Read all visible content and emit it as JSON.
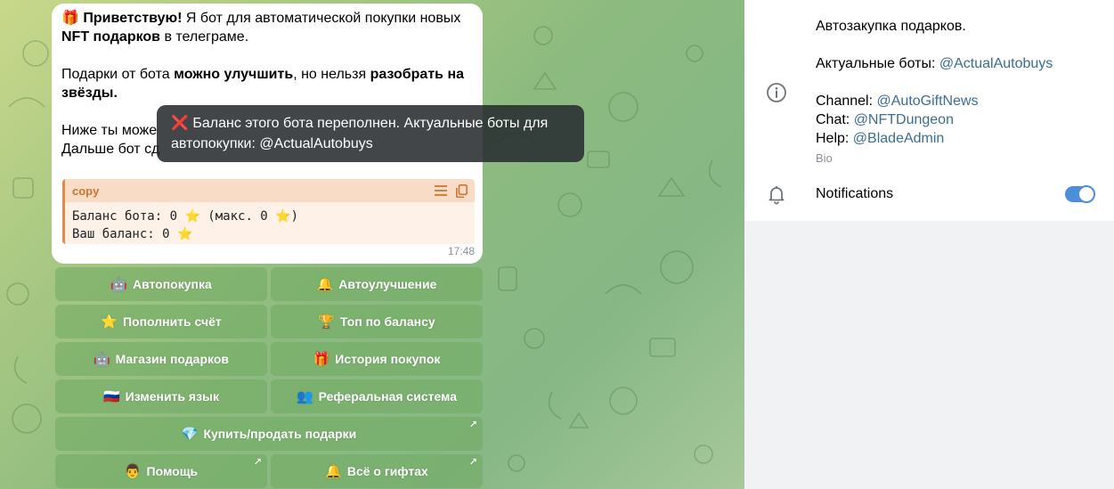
{
  "message": {
    "line1_icon": "🎁",
    "line1_bold": "Приветствую!",
    "line1_rest": " Я бот для автоматической покупки новых",
    "line2_bold": "NFT подарков",
    "line2_rest": " в телеграме.",
    "line3_a": "Подарки от бота ",
    "line3_bold1": "можно улучшить",
    "line3_b": ", но нельзя ",
    "line3_bold2": "разобрать на",
    "line4_bold": "звёзды.",
    "line5": "Ниже ты може",
    "line6": "Дальше бот сд",
    "code_lang": "copy",
    "code_line1_a": "Баланс бота: 0 ",
    "code_line1_b": " (макс. 0 ",
    "code_line1_c": ")",
    "code_line2": "Ваш баланс: 0 ",
    "star": "⭐",
    "time": "17:48"
  },
  "toast": {
    "icon": "❌",
    "text": " Баланс этого бота переполнен. Актуальные боты для автопокупки: @ActualAutobuys"
  },
  "keyboard": {
    "autobuy": {
      "emoji": "🤖",
      "label": "Автопокупка"
    },
    "autoupgrade": {
      "emoji": "🔔",
      "label": "Автоулучшение"
    },
    "topup": {
      "emoji": "⭐",
      "label": "Пополнить счёт"
    },
    "top": {
      "emoji": "🏆",
      "label": "Топ по балансу"
    },
    "shop": {
      "emoji": "🤖",
      "label": "Магазин подарков"
    },
    "history": {
      "emoji": "🎁",
      "label": "История покупок"
    },
    "language": {
      "emoji": "🇷🇺",
      "label": "Изменить язык"
    },
    "referral": {
      "emoji": "👥",
      "label": "Реферальная система"
    },
    "buysell": {
      "emoji": "💎",
      "label": "Купить/продать подарки",
      "arrow": "↗"
    },
    "help": {
      "emoji": "👨",
      "label": "Помощь",
      "arrow": "↗"
    },
    "about": {
      "emoji": "🔔",
      "label": "Всё о гифтах",
      "arrow": "↗"
    }
  },
  "profile": {
    "bio_line1": "Автозакупка подарков.",
    "actual_prefix": "Актуальные боты: ",
    "actual_link": "@ActualAutobuys",
    "channel_prefix": "Channel: ",
    "channel_link": "@AutoGiftNews",
    "chat_prefix": "Chat: ",
    "chat_link": "@NFTDungeon",
    "help_prefix": "Help: ",
    "help_link": "@BladeAdmin",
    "bio_label": "Bio",
    "notifications_label": "Notifications",
    "notifications_on": true
  },
  "colors": {
    "accent": "#4a8fd8",
    "link": "#3a6d99",
    "code_accent": "#e38c4a"
  }
}
